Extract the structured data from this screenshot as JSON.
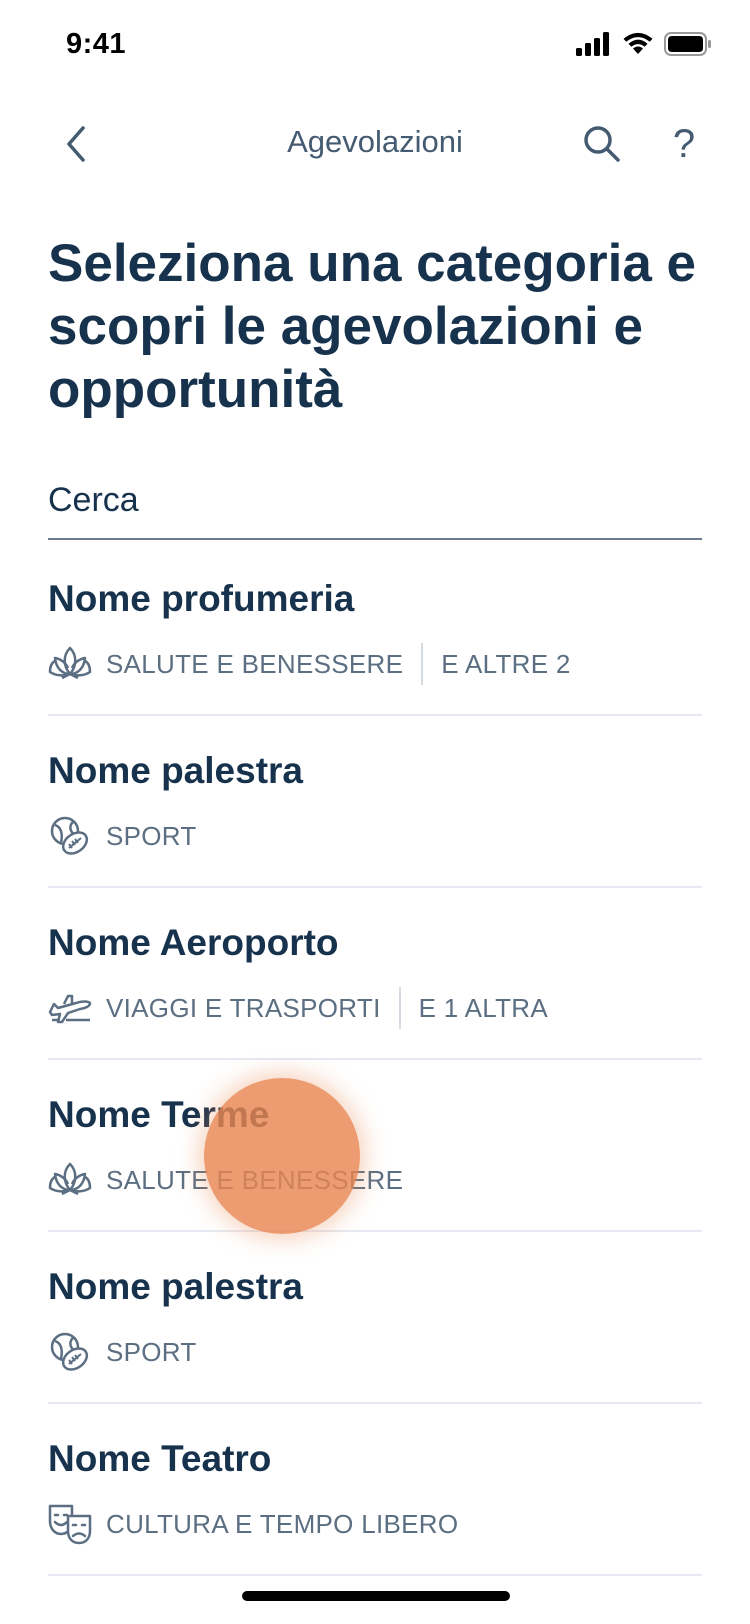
{
  "status_bar": {
    "time": "9:41",
    "icons": [
      "cellular-signal-icon",
      "wifi-icon",
      "battery-icon"
    ]
  },
  "nav": {
    "title": "Agevolazioni",
    "back_icon": "chevron-left-icon",
    "search_icon": "search-icon",
    "help_label": "?"
  },
  "page_title": "Seleziona una categoria e scopri le agevolazioni e opportunità",
  "search": {
    "placeholder": "Cerca"
  },
  "items": [
    {
      "title": "Nome profumeria",
      "category": "SALUTE E BENESSERE",
      "more": "E ALTRE 2",
      "icon": "lotus-icon"
    },
    {
      "title": "Nome palestra",
      "category": "SPORT",
      "more": "",
      "icon": "sport-balls-icon"
    },
    {
      "title": "Nome Aeroporto",
      "category": "VIAGGI E TRASPORTI",
      "more": "E 1 ALTRA",
      "icon": "airplane-icon"
    },
    {
      "title": "Nome Terme",
      "category": "SALUTE E BENESSERE",
      "more": "",
      "icon": "lotus-icon"
    },
    {
      "title": "Nome palestra",
      "category": "SPORT",
      "more": "",
      "icon": "sport-balls-icon"
    },
    {
      "title": "Nome Teatro",
      "category": "CULTURA E TEMPO LIBERO",
      "more": "",
      "icon": "theater-masks-icon"
    }
  ],
  "colors": {
    "primary_text": "#17324d",
    "secondary_text": "#5c6f82",
    "divider": "#e6e9f2",
    "touch_indicator": "#e88650"
  }
}
